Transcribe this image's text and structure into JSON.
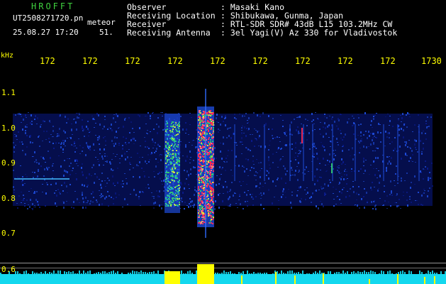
{
  "header": {
    "brand": "HROFFT",
    "filename": "UT2508271720.pn",
    "tag": "meteor",
    "datetime": "25.08.27 17:20",
    "count": "51.",
    "info": [
      {
        "label": "Observer",
        "value": ": Masaki Kano"
      },
      {
        "label": "Receiving Location",
        "value": ": Shibukawa, Gunma, Japan"
      },
      {
        "label": "Receiver",
        "value": ": RTL-SDR SDR# 43dB L15 103.2MHz CW"
      },
      {
        "label": "Receiving Antenna",
        "value": ": 3el Yagi(V) Az 330 for Vladivostok"
      }
    ]
  },
  "axes": {
    "unit_label": "kHz",
    "x_ticks": [
      "172",
      "172",
      "172",
      "172",
      "172",
      "172",
      "172",
      "172",
      "172",
      "1730"
    ],
    "y_ticks": [
      "1.1",
      "1.0",
      "0.9",
      "0.8",
      "0.7",
      "0.6"
    ]
  },
  "colors": {
    "background": "#000000",
    "text": "#ffffff",
    "brand": "#3fd13f",
    "axis_labels": "#ffff00",
    "noise_low": "#0a1a8a",
    "noise_mid": "#1e4bd8",
    "echo_mid": "#32d070",
    "echo_high": "#ff2a55",
    "bottom_band": "#14d8ee",
    "bottom_peaks": "#ffff00"
  }
}
